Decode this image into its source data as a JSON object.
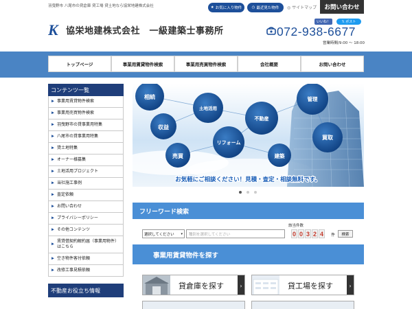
{
  "topbar": {
    "seo_text": "羽曳野市 八尾市の貸倉庫 貸工場 貸土地なら協栄地建株式会社",
    "favorites": "お気に入り物件",
    "recent": "最近見た物件",
    "sitemap": "サイトマップ",
    "contact": "お問い合わせ"
  },
  "header": {
    "logo_letter": "K",
    "company_name": "協栄地建株式会社　一級建築士事務所",
    "like": "いいね！",
    "post": "ポスト",
    "phone": "072-938-6677",
    "hours": "営業時間/9:00 ～ 18:00"
  },
  "nav": [
    {
      "label": "トップページ"
    },
    {
      "label": "事業用賃貸物件検索"
    },
    {
      "label": "事業用売買物件検索"
    },
    {
      "label": "会社概要"
    },
    {
      "label": "お問い合わせ"
    }
  ],
  "sidebar": {
    "title": "コンテンツ一覧",
    "items": [
      {
        "label": "事業用賃貸物件検索"
      },
      {
        "label": "事業用売買物件検索"
      },
      {
        "label": "羽曳野市の貸事業用特集"
      },
      {
        "label": "八尾市の貸事業用特集"
      },
      {
        "label": "貸土地特集"
      },
      {
        "label": "オーナー様募集"
      },
      {
        "label": "土地活用プロジェクト"
      },
      {
        "label": "当社施工事例"
      },
      {
        "label": "査定依頼"
      },
      {
        "label": "お問い合わせ"
      },
      {
        "label": "プライバシーポリシー"
      },
      {
        "label": "その他コンテンツ"
      },
      {
        "label": "賃貸借契約解約届（事業用物件）はこちら"
      },
      {
        "label": "空き物件客付依頼"
      },
      {
        "label": "改修工事見積依頼"
      }
    ],
    "section2_title": "不動産お役立ち情報"
  },
  "hero": {
    "bubbles": [
      {
        "label": "相続"
      },
      {
        "label": "土地活用"
      },
      {
        "label": "収益"
      },
      {
        "label": "不動産"
      },
      {
        "label": "管理"
      },
      {
        "label": "リフォーム"
      },
      {
        "label": "売買"
      },
      {
        "label": "建築"
      },
      {
        "label": "買取"
      }
    ],
    "tagline": "お気軽にご相談ください！見積・査定・相談無料です。"
  },
  "search": {
    "title": "フリーワード検索",
    "count_label": "該当件数",
    "select_placeholder": "選択してください",
    "keyword_placeholder": "種別を選択してください",
    "count_digits": [
      "0",
      "0",
      "3",
      "2",
      "4"
    ],
    "unit": "件",
    "button": "検索"
  },
  "rent": {
    "title": "事業用賃貸物件を探す",
    "cards": [
      {
        "label": "貸倉庫を探す"
      },
      {
        "label": "貸工場を探す"
      }
    ]
  },
  "colors": {
    "primary": "#1d4f9a",
    "nav_bg": "#4a84c4",
    "section_blue": "#4a8fd6",
    "sidebar_head": "#1f3e7a"
  }
}
